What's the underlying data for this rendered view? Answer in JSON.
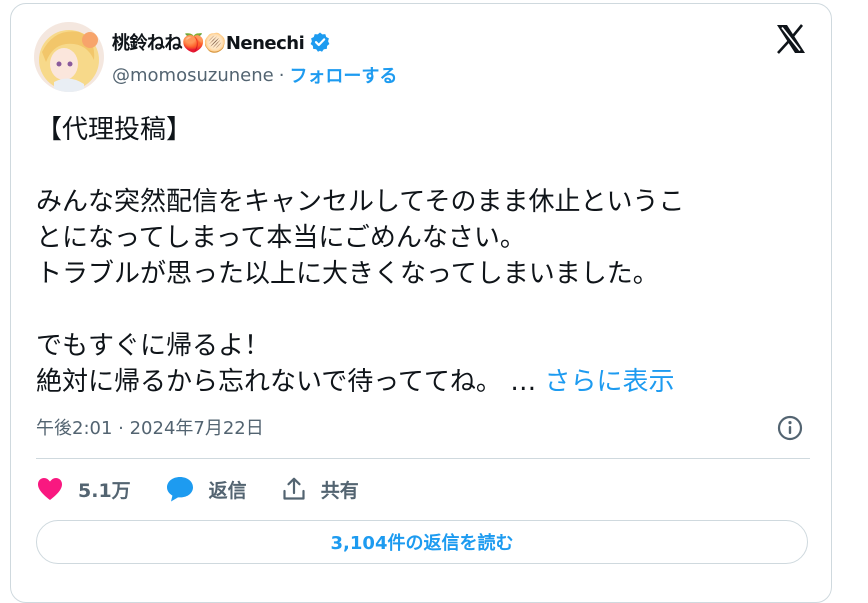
{
  "author": {
    "display_name": "桃鈴ねね🍑🫓Nenechi",
    "handle": "@momosuzunene",
    "separator": "·",
    "follow_label": "フォローする"
  },
  "tweet": {
    "lines": [
      "【代理投稿】",
      "",
      "みんな突然配信をキャンセルしてそのまま休止というこ",
      "とになってしまって本当にごめんなさい。",
      "トラブルが思った以上に大きくなってしまいました。",
      "",
      "でもすぐに帰るよ！",
      "絶対に帰るから忘れないで待っててね。"
    ],
    "ellipsis": "…",
    "show_more_label": "さらに表示",
    "timestamp": "午後2:01 · 2024年7月22日"
  },
  "actions": {
    "like_count": "5.1万",
    "reply_label": "返信",
    "share_label": "共有"
  },
  "read_replies_label": "3,104件の返信を読む",
  "colors": {
    "accent": "#1d9bf0",
    "like": "#f91880",
    "text": "#0f1419",
    "muted": "#536471",
    "border": "#cfd9de"
  }
}
